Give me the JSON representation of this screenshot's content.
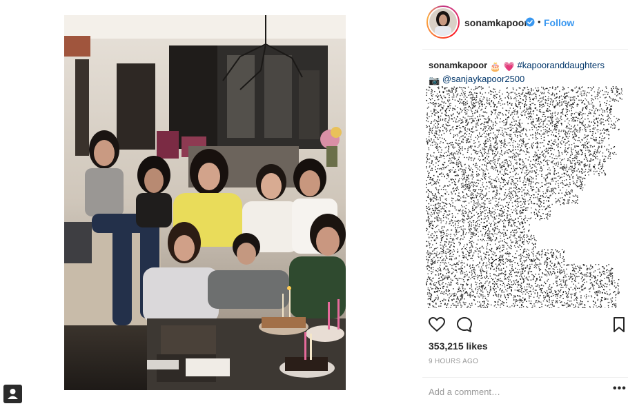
{
  "post": {
    "username": "sonamkapoor",
    "follow_label": "Follow",
    "separator": "•",
    "caption": {
      "user": "sonamkapoor",
      "emoji_1": "🎂",
      "emoji_2": "💗",
      "hashtag": "#kapooranddaughters",
      "camera_emoji": "📷",
      "mention": "@sanjaykapoor2500"
    },
    "likes": "353,215 likes",
    "time_ago": "9 HOURS AGO",
    "comment_placeholder": "Add a comment…",
    "more_label": "•••"
  },
  "icons": {
    "like": "heart-icon",
    "comment": "comment-icon",
    "save": "bookmark-icon",
    "verified": "verified-badge-icon"
  },
  "colors": {
    "link": "#3897f0",
    "hashtag": "#003569",
    "muted": "#999999",
    "text": "#262626"
  }
}
